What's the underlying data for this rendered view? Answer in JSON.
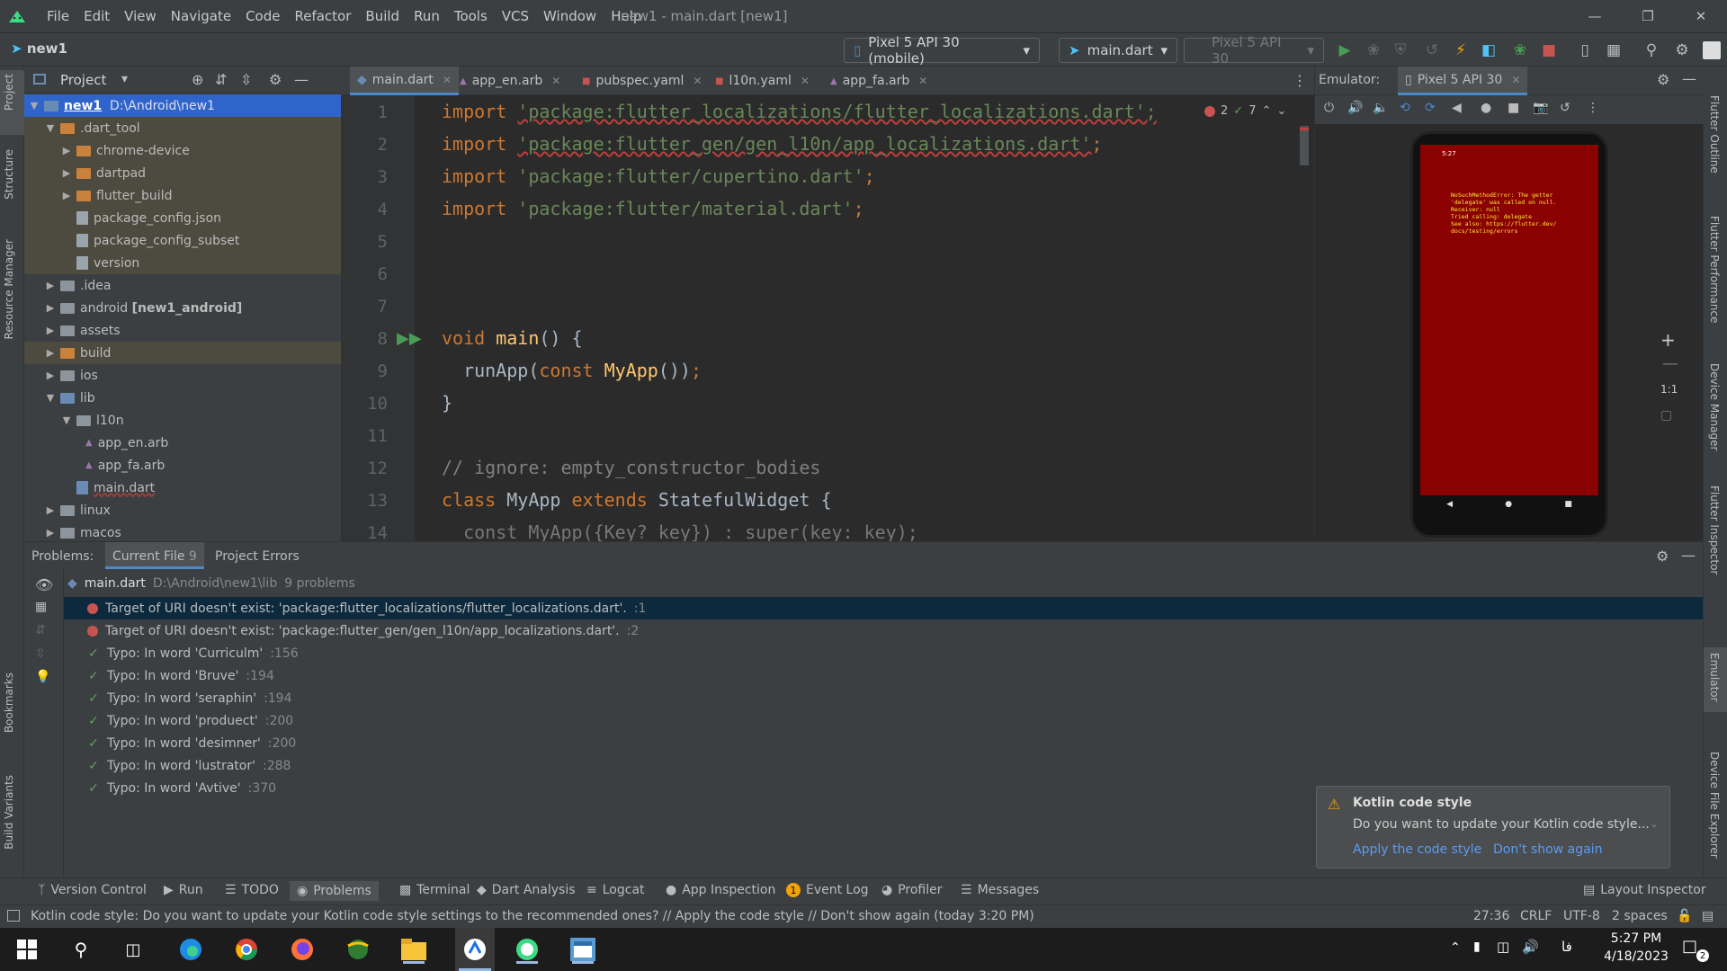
{
  "menubar": {
    "items": [
      "File",
      "Edit",
      "View",
      "Navigate",
      "Code",
      "Refactor",
      "Build",
      "Run",
      "Tools",
      "VCS",
      "Window",
      "Help"
    ],
    "window_title": "new1 - main.dart [new1]"
  },
  "navbar": {
    "project": "new1",
    "device_selector": "Pixel 5 API 30 (mobile)",
    "run_config": "main.dart",
    "device2": "Pixel 5 API 30"
  },
  "left_strip": {
    "project": "Project",
    "structure": "Structure",
    "resource_manager": "Resource Manager",
    "bookmarks": "Bookmarks",
    "build_variants": "Build Variants"
  },
  "right_strip": {
    "flutter_outline": "Flutter Outline",
    "flutter_performance": "Flutter Performance",
    "device_manager": "Device Manager",
    "flutter_inspector": "Flutter Inspector",
    "emulator": "Emulator",
    "device_file_explorer": "Device File Explorer"
  },
  "project_panel": {
    "title": "Project",
    "tree": [
      {
        "label": "new1",
        "suffix": "D:\\Android\\new1"
      },
      {
        "label": ".dart_tool"
      },
      {
        "label": "chrome-device"
      },
      {
        "label": "dartpad"
      },
      {
        "label": "flutter_build"
      },
      {
        "label": "package_config.json"
      },
      {
        "label": "package_config_subset"
      },
      {
        "label": "version"
      },
      {
        "label": ".idea"
      },
      {
        "label": "android",
        "suffix": "[new1_android]"
      },
      {
        "label": "assets"
      },
      {
        "label": "build"
      },
      {
        "label": "ios"
      },
      {
        "label": "lib"
      },
      {
        "label": "l10n"
      },
      {
        "label": "app_en.arb"
      },
      {
        "label": "app_fa.arb"
      },
      {
        "label": "main.dart"
      },
      {
        "label": "linux"
      },
      {
        "label": "macos"
      }
    ]
  },
  "editor": {
    "tabs": [
      "main.dart",
      "app_en.arb",
      "pubspec.yaml",
      "l10n.yaml",
      "app_fa.arb"
    ],
    "error_count": "2",
    "typo_count": "7",
    "line_numbers": [
      "1",
      "2",
      "3",
      "4",
      "5",
      "6",
      "7",
      "8",
      "9",
      "10",
      "11",
      "12",
      "13",
      "14"
    ],
    "lines": {
      "l1_kw": "import ",
      "l1_str": "'package:flutter_localizations/flutter_localizations.dart';",
      "l2_kw": "import ",
      "l2_str": "'package:flutter_gen/gen_l10n/app_localizations.dart'",
      "l2_end": ";",
      "l3_kw": "import ",
      "l3_str": "'package:flutter/cupertino.dart'",
      "l3_end": ";",
      "l4_kw": "import ",
      "l4_str": "'package:flutter/material.dart'",
      "l4_end": ";",
      "l8_kw": "void ",
      "l8_fn": "main",
      "l8_rest": "() {",
      "l9_a": "  runApp(",
      "l9_kw": "const ",
      "l9_fn": "MyApp",
      "l9_b": "())",
      "l9_end": ";",
      "l10": "}",
      "l12": "// ignore: empty_constructor_bodies",
      "l13_kw": "class ",
      "l13_name": "MyApp ",
      "l13_kw2": "extends ",
      "l13_rest": "StatefulWidget {",
      "l14": "  const MyApp({Key? key}) : super(key: key);"
    }
  },
  "emulator": {
    "label": "Emulator:",
    "device_tab": "Pixel 5 API 30",
    "status_time": "5:27",
    "error_text": "NoSuchMethodError: The getter\n'delegate' was called on null.\nReceiver: null\nTried calling: delegate\nSee also: https://flutter.dev/\ndocs/testing/errors",
    "zoom_ratio": "1:1"
  },
  "problems": {
    "title": "Problems:",
    "tabs": [
      {
        "label": "Current File",
        "count": "9"
      },
      {
        "label": "Project Errors",
        "count": ""
      }
    ],
    "file": {
      "name": "main.dart",
      "path": "D:\\Android\\new1\\lib",
      "count": "9 problems"
    },
    "items": [
      {
        "type": "error",
        "text": "Target of URI doesn't exist: 'package:flutter_localizations/flutter_localizations.dart'.",
        "loc": ":1"
      },
      {
        "type": "error",
        "text": "Target of URI doesn't exist: 'package:flutter_gen/gen_l10n/app_localizations.dart'.",
        "loc": ":2"
      },
      {
        "type": "typo",
        "text": "Typo: In word 'Curriculm'",
        "loc": ":156"
      },
      {
        "type": "typo",
        "text": "Typo: In word 'Bruve'",
        "loc": ":194"
      },
      {
        "type": "typo",
        "text": "Typo: In word 'seraphin'",
        "loc": ":194"
      },
      {
        "type": "typo",
        "text": "Typo: In word 'produect'",
        "loc": ":200"
      },
      {
        "type": "typo",
        "text": "Typo: In word 'desimner'",
        "loc": ":200"
      },
      {
        "type": "typo",
        "text": "Typo: In word 'lustrator'",
        "loc": ":288"
      },
      {
        "type": "typo",
        "text": "Typo: In word 'Avtive'",
        "loc": ":370"
      }
    ]
  },
  "notification": {
    "title": "Kotlin code style",
    "body": "Do you want to update your Kotlin code style...",
    "action1": "Apply the code style",
    "action2": "Don't show again"
  },
  "bottom_tools": [
    "Version Control",
    "Run",
    "TODO",
    "Problems",
    "Terminal",
    "Dart Analysis",
    "Logcat",
    "App Inspection",
    "Event Log",
    "Profiler",
    "Messages"
  ],
  "event_log_count": "1",
  "layout_inspector": "Layout Inspector",
  "status": {
    "message": "Kotlin code style: Do you want to update your Kotlin code style settings to the recommended ones? // Apply the code style // Don't show again (today 3:20 PM)",
    "position": "27:36",
    "line_sep": "CRLF",
    "encoding": "UTF-8",
    "indent": "2 spaces"
  },
  "taskbar": {
    "time": "5:27 PM",
    "date": "4/18/2023",
    "lang": "فا",
    "notif_count": "2"
  },
  "colors": {
    "accent": "#2f65ca",
    "error_screen": "#8b0000",
    "keyword": "#cc7832",
    "string": "#6a8759"
  }
}
